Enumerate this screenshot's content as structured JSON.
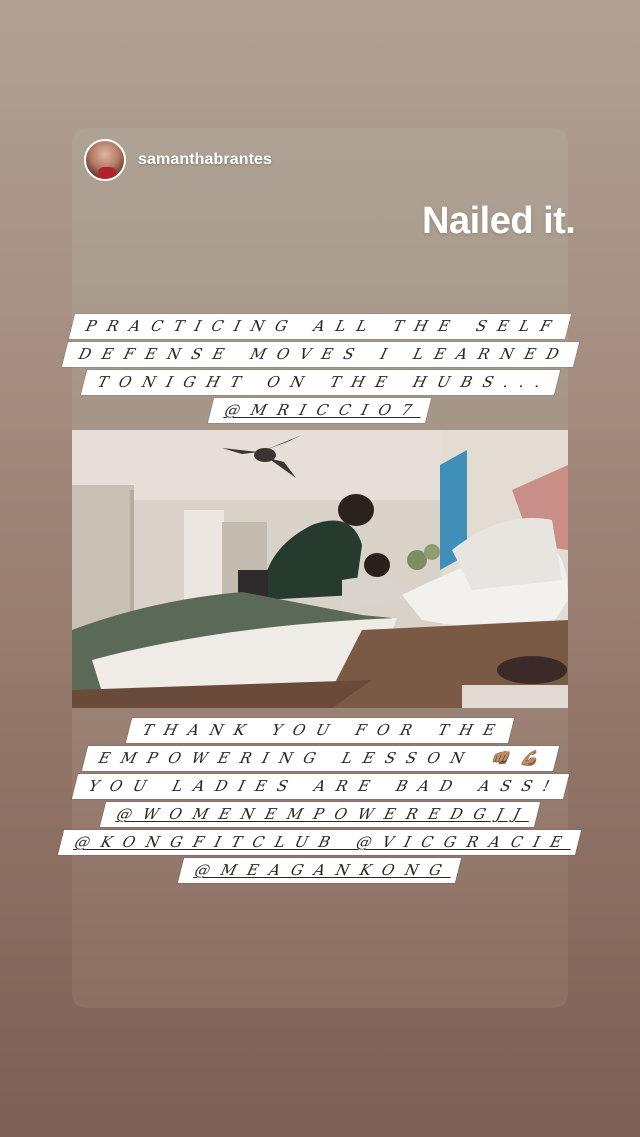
{
  "story": {
    "username": "samanthabrantes",
    "sticker_text": "Nailed it.",
    "caption_top": [
      {
        "text": "PRACTICING ALL THE SELF",
        "underline": false
      },
      {
        "text": "DEFENSE MOVES I LEARNED",
        "underline": false
      },
      {
        "text": "TONIGHT ON THE HUBS...",
        "underline": false
      },
      {
        "text": "@MRICCIO7",
        "underline": true
      }
    ],
    "caption_bottom": [
      {
        "text": "THANK YOU FOR THE",
        "underline": false
      },
      {
        "text": "EMPOWERING LESSON 👊🏽💪🏽",
        "underline": false
      },
      {
        "text": "YOU LADIES ARE BAD ASS!",
        "underline": false
      },
      {
        "text": "@WOMENEMPOWEREDGJJ",
        "underline": true
      },
      {
        "text": "@KONGFITCLUB @VICGRACIE",
        "underline": true
      },
      {
        "text": "@MEAGANKONG",
        "underline": true
      }
    ]
  },
  "colors": {
    "background_top": "#b0a195",
    "background_bottom": "#7d5f55",
    "caption_bg": "#ffffff",
    "caption_text": "#2a2623"
  }
}
